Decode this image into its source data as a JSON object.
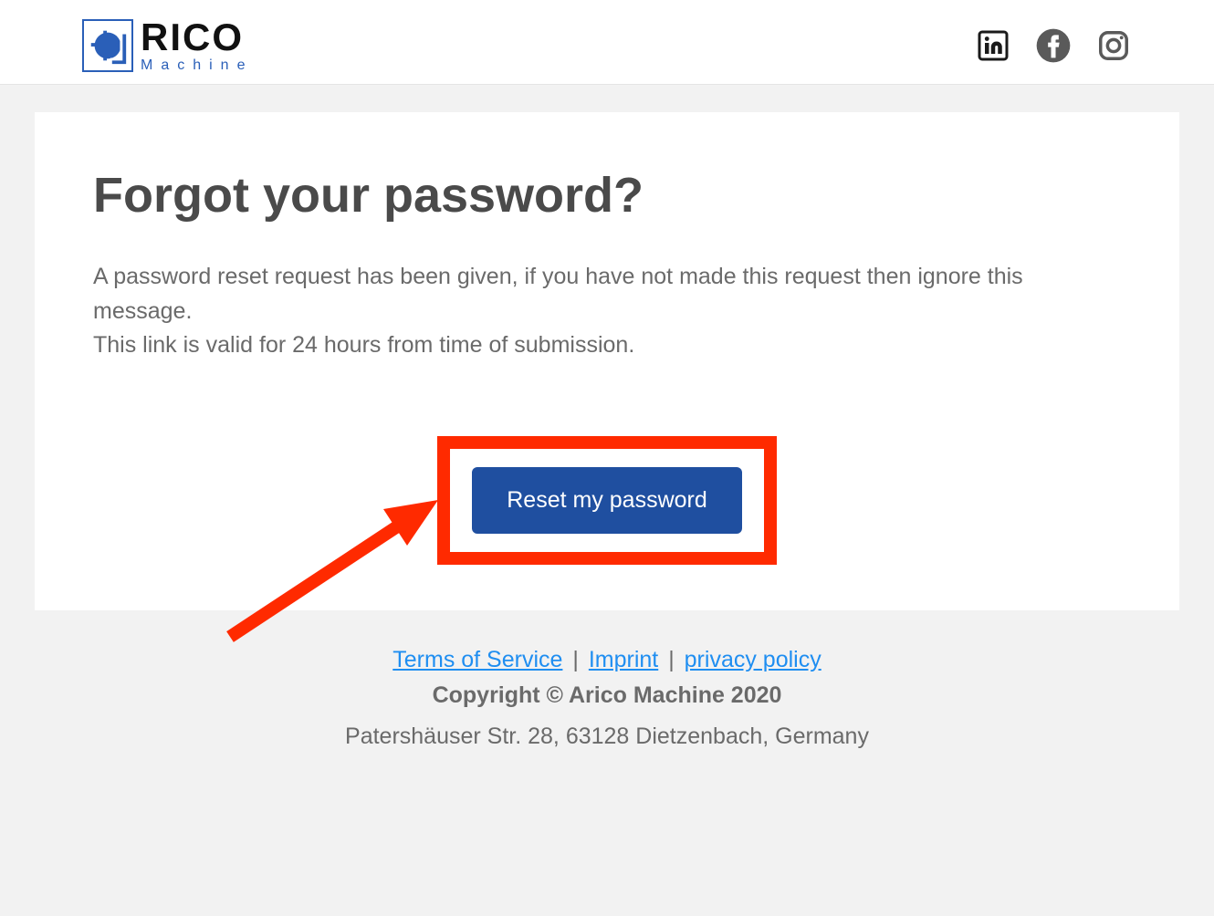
{
  "brand": {
    "name_main": "RICO",
    "name_sub": "Machine"
  },
  "social": {
    "linkedin": "linkedin-icon",
    "facebook": "facebook-icon",
    "instagram": "instagram-icon"
  },
  "main": {
    "title": "Forgot your password?",
    "paragraph1": "A password reset request has been given, if you have not made this request then ignore this message.",
    "paragraph2": "This link is valid for 24 hours from time of submission.",
    "reset_label": "Reset my password"
  },
  "footer": {
    "terms": "Terms of Service",
    "imprint": "Imprint",
    "privacy": "privacy policy",
    "separator": " | ",
    "copyright": "Copyright © Arico Machine 2020",
    "address": "Patershäuser Str. 28, 63128 Dietzenbach, Germany"
  },
  "colors": {
    "accent": "#1f4fa0",
    "highlight": "#ff2a00",
    "link": "#1f8ef1"
  }
}
